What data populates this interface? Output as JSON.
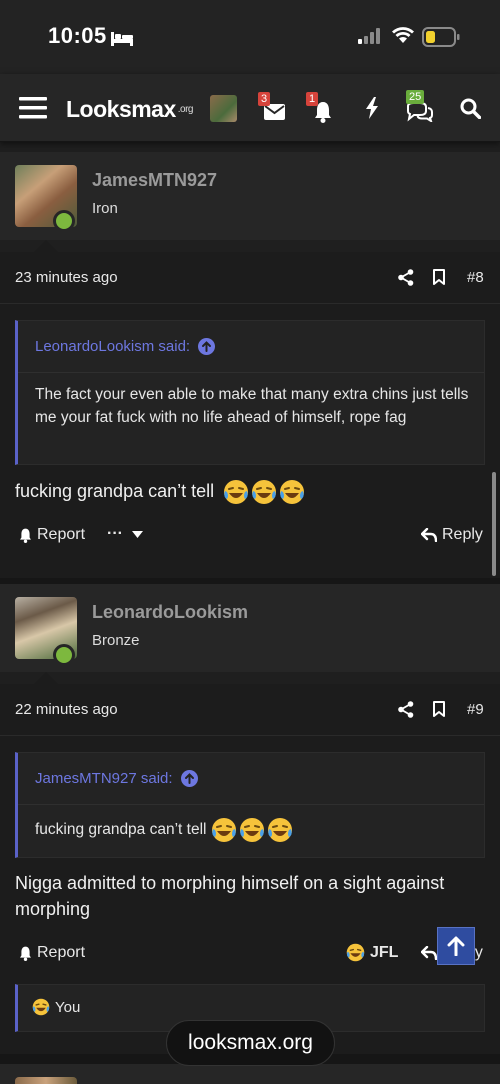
{
  "status_bar": {
    "time": "10:05"
  },
  "navbar": {
    "logo_text": "Looksmax",
    "logo_suffix": ".org",
    "inbox_badge": "3",
    "alerts_badge": "1",
    "chats_badge": "25"
  },
  "posts": [
    {
      "username": "JamesMTN927",
      "rank": "Iron",
      "time": "23 minutes ago",
      "number": "#8",
      "quote_author": "LeonardoLookism said:",
      "quote_text": "The fact your even able to make that many extra chins just tells me your fat fuck with no life ahead of himself, rope fag",
      "text": "fucking grandpa can’t tell",
      "report_label": "Report",
      "more_label": "···",
      "reply_label": "Reply"
    },
    {
      "username": "LeonardoLookism",
      "rank": "Bronze",
      "time": "22 minutes ago",
      "number": "#9",
      "quote_author": "JamesMTN927 said:",
      "quote_text": "fucking grandpa can’t tell",
      "text": "Nigga admitted to morphing himself on a sight against morphing",
      "report_label": "Report",
      "reaction_label": "JFL",
      "reply_label": "Reply",
      "reactions_by": "You"
    }
  ],
  "browser": {
    "url": "looksmax.org"
  },
  "colors": {
    "accent_link": "#6d77e0",
    "online": "#7db83e",
    "badge_red": "#d6433b",
    "badge_green": "#6aad3c"
  }
}
